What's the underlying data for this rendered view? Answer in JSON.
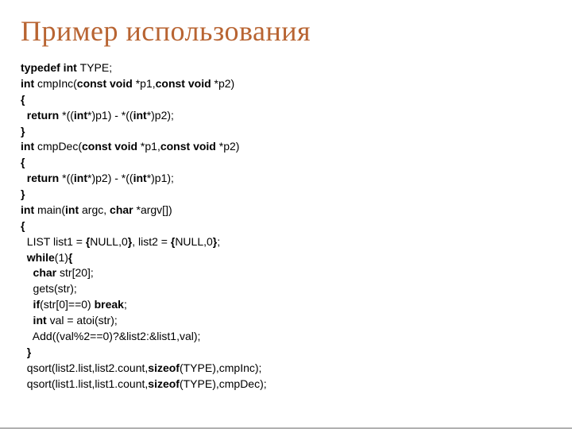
{
  "title": "Пример использования",
  "code": {
    "l1_a": "typedef int ",
    "l1_b": "TYPE;",
    "l2_a": "int ",
    "l2_b": "cmpInc(",
    "l2_c": "const void ",
    "l2_d": "*p1,",
    "l2_e": "const void ",
    "l2_f": "*p2)",
    "l3": "{",
    "l4_a": "  return ",
    "l4_b": "*((",
    "l4_c": "int",
    "l4_d": "*)p1) - *((",
    "l4_e": "int",
    "l4_f": "*)p2);",
    "l5": "}",
    "l6_a": "int ",
    "l6_b": "cmpDec(",
    "l6_c": "const void ",
    "l6_d": "*p1,",
    "l6_e": "const void ",
    "l6_f": "*p2)",
    "l7": "{",
    "l8_a": "  return ",
    "l8_b": "*((",
    "l8_c": "int",
    "l8_d": "*)p2) - *((",
    "l8_e": "int",
    "l8_f": "*)p1);",
    "l9": "}",
    "l10_a": "int ",
    "l10_b": "main(",
    "l10_c": "int ",
    "l10_d": "argc, ",
    "l10_e": "char ",
    "l10_f": "*argv[])",
    "l11": "{",
    "l12_a": "  LIST list1 = ",
    "l12_b": "{",
    "l12_c": "NULL,0",
    "l12_d": "}",
    "l12_e": ", list2 = ",
    "l12_f": "{",
    "l12_g": "NULL,0",
    "l12_h": "}",
    "l12_i": ";",
    "l13_a": "  while",
    "l13_b": "(1)",
    "l13_c": "{",
    "l14_a": "    char ",
    "l14_b": "str[20];",
    "l15": "    gets(str);",
    "l16_a": "    if",
    "l16_b": "(str[0]==0) ",
    "l16_c": "break",
    "l16_d": ";",
    "l17_a": "    int ",
    "l17_b": "val = atoi(str);",
    "l18": "    Add((val%2==0)?&list2:&list1,val);",
    "l19_a": "  ",
    "l19_b": "}",
    "l20_a": "  qsort(list2.list,list2.count,",
    "l20_b": "sizeof",
    "l20_c": "(TYPE),cmpInc);",
    "l21_a": "  qsort(list1.list,list1.count,",
    "l21_b": "sizeof",
    "l21_c": "(TYPE),cmpDec);"
  }
}
